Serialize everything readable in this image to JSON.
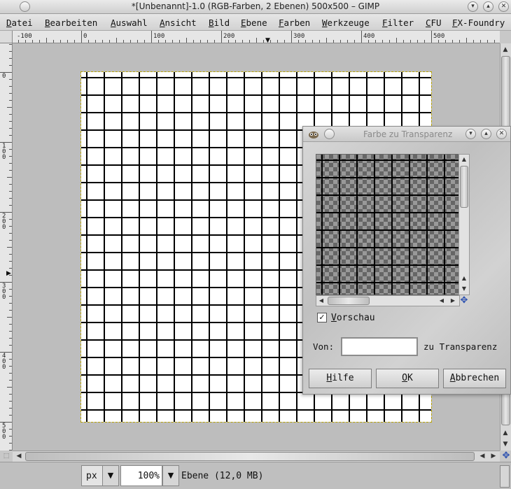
{
  "window": {
    "title": "*[Unbenannt]-1.0 (RGB-Farben, 2 Ebenen) 500x500 – GIMP",
    "menu_icon": "circle-menu-icon",
    "controls": [
      "minimize",
      "maximize",
      "close"
    ]
  },
  "menubar": {
    "items": [
      "Datei",
      "Bearbeiten",
      "Auswahl",
      "Ansicht",
      "Bild",
      "Ebene",
      "Farben",
      "Werkzeuge",
      "Filter",
      "CFU",
      "FX-Foundry"
    ]
  },
  "rulers": {
    "horizontal": [
      "-100",
      "0",
      "100",
      "200",
      "300",
      "400",
      "500"
    ],
    "vertical": [
      "0",
      "100",
      "200",
      "300",
      "400",
      "500"
    ]
  },
  "image": {
    "grid_color": "#000000",
    "background": "#ffffff"
  },
  "statusbar": {
    "unit": "px",
    "zoom": "100",
    "zoom_unit": "%",
    "layer_info": "Ebene (12,0 MB)"
  },
  "dialog": {
    "title": "Farbe zu Transparenz",
    "preview_label": "Vorschau",
    "preview_checked": true,
    "from_label": "Von:",
    "from_value": "",
    "to_label": "zu Transparenz",
    "buttons": {
      "help": "Hilfe",
      "ok": "OK",
      "cancel": "Abbrechen"
    }
  }
}
